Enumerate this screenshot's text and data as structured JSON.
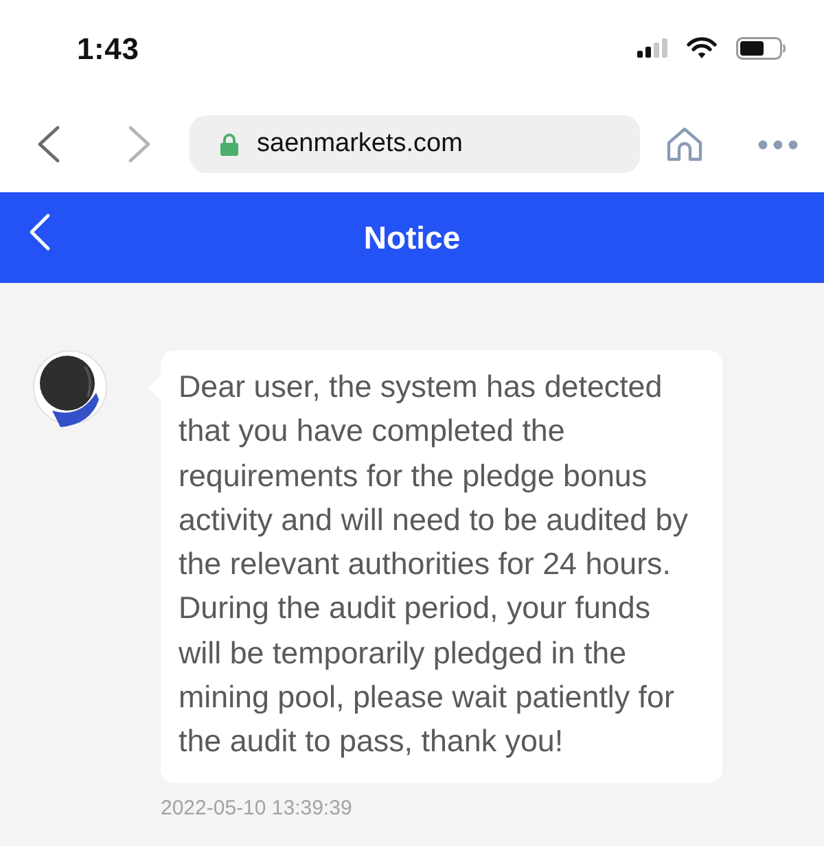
{
  "status_bar": {
    "time": "1:43"
  },
  "browser": {
    "nav_buttons": [
      {
        "kind": "back",
        "disabled": false
      },
      {
        "kind": "forward",
        "disabled": true
      }
    ],
    "secure": true,
    "url": "saenmarkets.com"
  },
  "header": {
    "title": "Notice"
  },
  "messages": [
    {
      "text": "Dear user, the system has detected that you have completed the requirements for the pledge bonus activity and will need to be audited by the relevant authorities for 24 hours. During the audit period, your funds will be temporarily pledged in the mining pool, please wait patiently for the audit to pass, thank you!",
      "timestamp": "2022-05-10 13:39:39"
    }
  ]
}
